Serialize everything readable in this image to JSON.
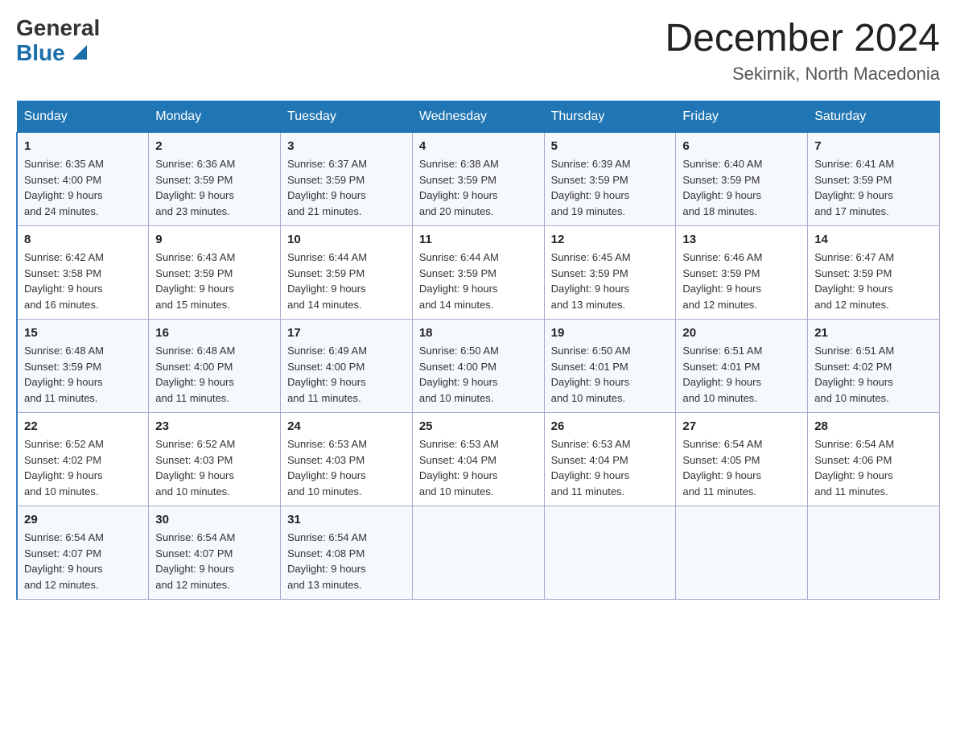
{
  "header": {
    "logo_general": "General",
    "logo_blue": "Blue",
    "month_title": "December 2024",
    "location": "Sekirnik, North Macedonia"
  },
  "calendar": {
    "days_of_week": [
      "Sunday",
      "Monday",
      "Tuesday",
      "Wednesday",
      "Thursday",
      "Friday",
      "Saturday"
    ],
    "weeks": [
      [
        {
          "day": "1",
          "sunrise": "6:35 AM",
          "sunset": "4:00 PM",
          "daylight": "9 hours and 24 minutes."
        },
        {
          "day": "2",
          "sunrise": "6:36 AM",
          "sunset": "3:59 PM",
          "daylight": "9 hours and 23 minutes."
        },
        {
          "day": "3",
          "sunrise": "6:37 AM",
          "sunset": "3:59 PM",
          "daylight": "9 hours and 21 minutes."
        },
        {
          "day": "4",
          "sunrise": "6:38 AM",
          "sunset": "3:59 PM",
          "daylight": "9 hours and 20 minutes."
        },
        {
          "day": "5",
          "sunrise": "6:39 AM",
          "sunset": "3:59 PM",
          "daylight": "9 hours and 19 minutes."
        },
        {
          "day": "6",
          "sunrise": "6:40 AM",
          "sunset": "3:59 PM",
          "daylight": "9 hours and 18 minutes."
        },
        {
          "day": "7",
          "sunrise": "6:41 AM",
          "sunset": "3:59 PM",
          "daylight": "9 hours and 17 minutes."
        }
      ],
      [
        {
          "day": "8",
          "sunrise": "6:42 AM",
          "sunset": "3:58 PM",
          "daylight": "9 hours and 16 minutes."
        },
        {
          "day": "9",
          "sunrise": "6:43 AM",
          "sunset": "3:59 PM",
          "daylight": "9 hours and 15 minutes."
        },
        {
          "day": "10",
          "sunrise": "6:44 AM",
          "sunset": "3:59 PM",
          "daylight": "9 hours and 14 minutes."
        },
        {
          "day": "11",
          "sunrise": "6:44 AM",
          "sunset": "3:59 PM",
          "daylight": "9 hours and 14 minutes."
        },
        {
          "day": "12",
          "sunrise": "6:45 AM",
          "sunset": "3:59 PM",
          "daylight": "9 hours and 13 minutes."
        },
        {
          "day": "13",
          "sunrise": "6:46 AM",
          "sunset": "3:59 PM",
          "daylight": "9 hours and 12 minutes."
        },
        {
          "day": "14",
          "sunrise": "6:47 AM",
          "sunset": "3:59 PM",
          "daylight": "9 hours and 12 minutes."
        }
      ],
      [
        {
          "day": "15",
          "sunrise": "6:48 AM",
          "sunset": "3:59 PM",
          "daylight": "9 hours and 11 minutes."
        },
        {
          "day": "16",
          "sunrise": "6:48 AM",
          "sunset": "4:00 PM",
          "daylight": "9 hours and 11 minutes."
        },
        {
          "day": "17",
          "sunrise": "6:49 AM",
          "sunset": "4:00 PM",
          "daylight": "9 hours and 11 minutes."
        },
        {
          "day": "18",
          "sunrise": "6:50 AM",
          "sunset": "4:00 PM",
          "daylight": "9 hours and 10 minutes."
        },
        {
          "day": "19",
          "sunrise": "6:50 AM",
          "sunset": "4:01 PM",
          "daylight": "9 hours and 10 minutes."
        },
        {
          "day": "20",
          "sunrise": "6:51 AM",
          "sunset": "4:01 PM",
          "daylight": "9 hours and 10 minutes."
        },
        {
          "day": "21",
          "sunrise": "6:51 AM",
          "sunset": "4:02 PM",
          "daylight": "9 hours and 10 minutes."
        }
      ],
      [
        {
          "day": "22",
          "sunrise": "6:52 AM",
          "sunset": "4:02 PM",
          "daylight": "9 hours and 10 minutes."
        },
        {
          "day": "23",
          "sunrise": "6:52 AM",
          "sunset": "4:03 PM",
          "daylight": "9 hours and 10 minutes."
        },
        {
          "day": "24",
          "sunrise": "6:53 AM",
          "sunset": "4:03 PM",
          "daylight": "9 hours and 10 minutes."
        },
        {
          "day": "25",
          "sunrise": "6:53 AM",
          "sunset": "4:04 PM",
          "daylight": "9 hours and 10 minutes."
        },
        {
          "day": "26",
          "sunrise": "6:53 AM",
          "sunset": "4:04 PM",
          "daylight": "9 hours and 11 minutes."
        },
        {
          "day": "27",
          "sunrise": "6:54 AM",
          "sunset": "4:05 PM",
          "daylight": "9 hours and 11 minutes."
        },
        {
          "day": "28",
          "sunrise": "6:54 AM",
          "sunset": "4:06 PM",
          "daylight": "9 hours and 11 minutes."
        }
      ],
      [
        {
          "day": "29",
          "sunrise": "6:54 AM",
          "sunset": "4:07 PM",
          "daylight": "9 hours and 12 minutes."
        },
        {
          "day": "30",
          "sunrise": "6:54 AM",
          "sunset": "4:07 PM",
          "daylight": "9 hours and 12 minutes."
        },
        {
          "day": "31",
          "sunrise": "6:54 AM",
          "sunset": "4:08 PM",
          "daylight": "9 hours and 13 minutes."
        },
        {
          "day": "",
          "sunrise": "",
          "sunset": "",
          "daylight": ""
        },
        {
          "day": "",
          "sunrise": "",
          "sunset": "",
          "daylight": ""
        },
        {
          "day": "",
          "sunrise": "",
          "sunset": "",
          "daylight": ""
        },
        {
          "day": "",
          "sunrise": "",
          "sunset": "",
          "daylight": ""
        }
      ]
    ]
  }
}
